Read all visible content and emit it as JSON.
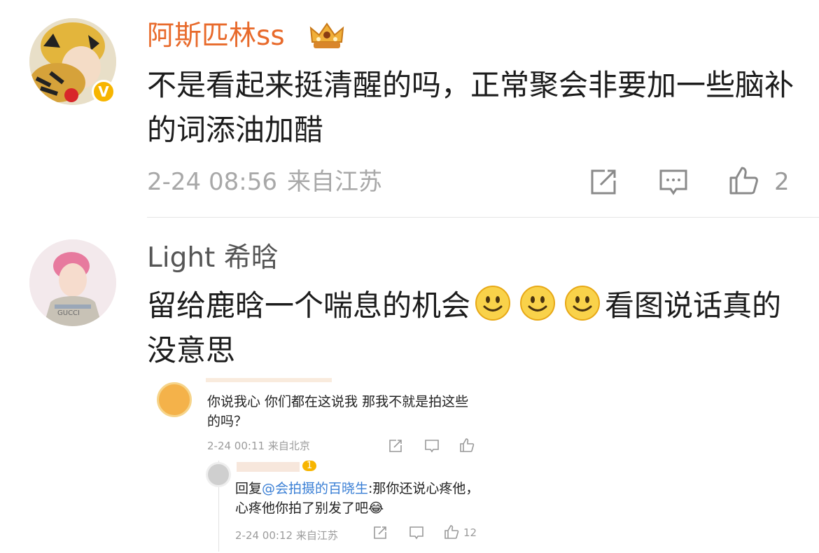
{
  "comment1": {
    "username": "阿斯匹林ss",
    "text": "不是看起来挺清醒的吗，正常聚会非要加一些脑补的词添油加醋",
    "timestamp": "2-24 08:56",
    "location": "来自江苏",
    "like_count": "2",
    "verified_badge": "V"
  },
  "comment2": {
    "username": "Light 希晗",
    "text_before_emoji": "留给鹿晗一个喘息的机会",
    "text_after_emoji": "看图说话真的没意思",
    "emoji_count": 3,
    "emoji": "smile-emoji"
  },
  "embedded_screenshot": {
    "top_comment": {
      "text": "你说我心 你们都在这说我 那我不就是拍这些的吗？",
      "timestamp": "2-24 00:11",
      "location": "来自北京"
    },
    "reply": {
      "badge_level": "1",
      "reply_prefix": "回复",
      "reply_target": "@会拍摄的百晓生",
      "reply_text": ":那你还说心疼他，心疼他你拍了别发了吧😂",
      "timestamp": "2-24 00:12",
      "location": "来自江苏",
      "like_count": "12"
    }
  },
  "colors": {
    "username_orange": "#e86a2b",
    "meta_gray": "#a8a8a8",
    "link_blue": "#3a7fd5",
    "badge_yellow": "#f7b500"
  },
  "icons": [
    "repost-icon",
    "comment-icon",
    "like-icon",
    "crown-badge-icon",
    "verified-icon",
    "smile-emoji"
  ]
}
